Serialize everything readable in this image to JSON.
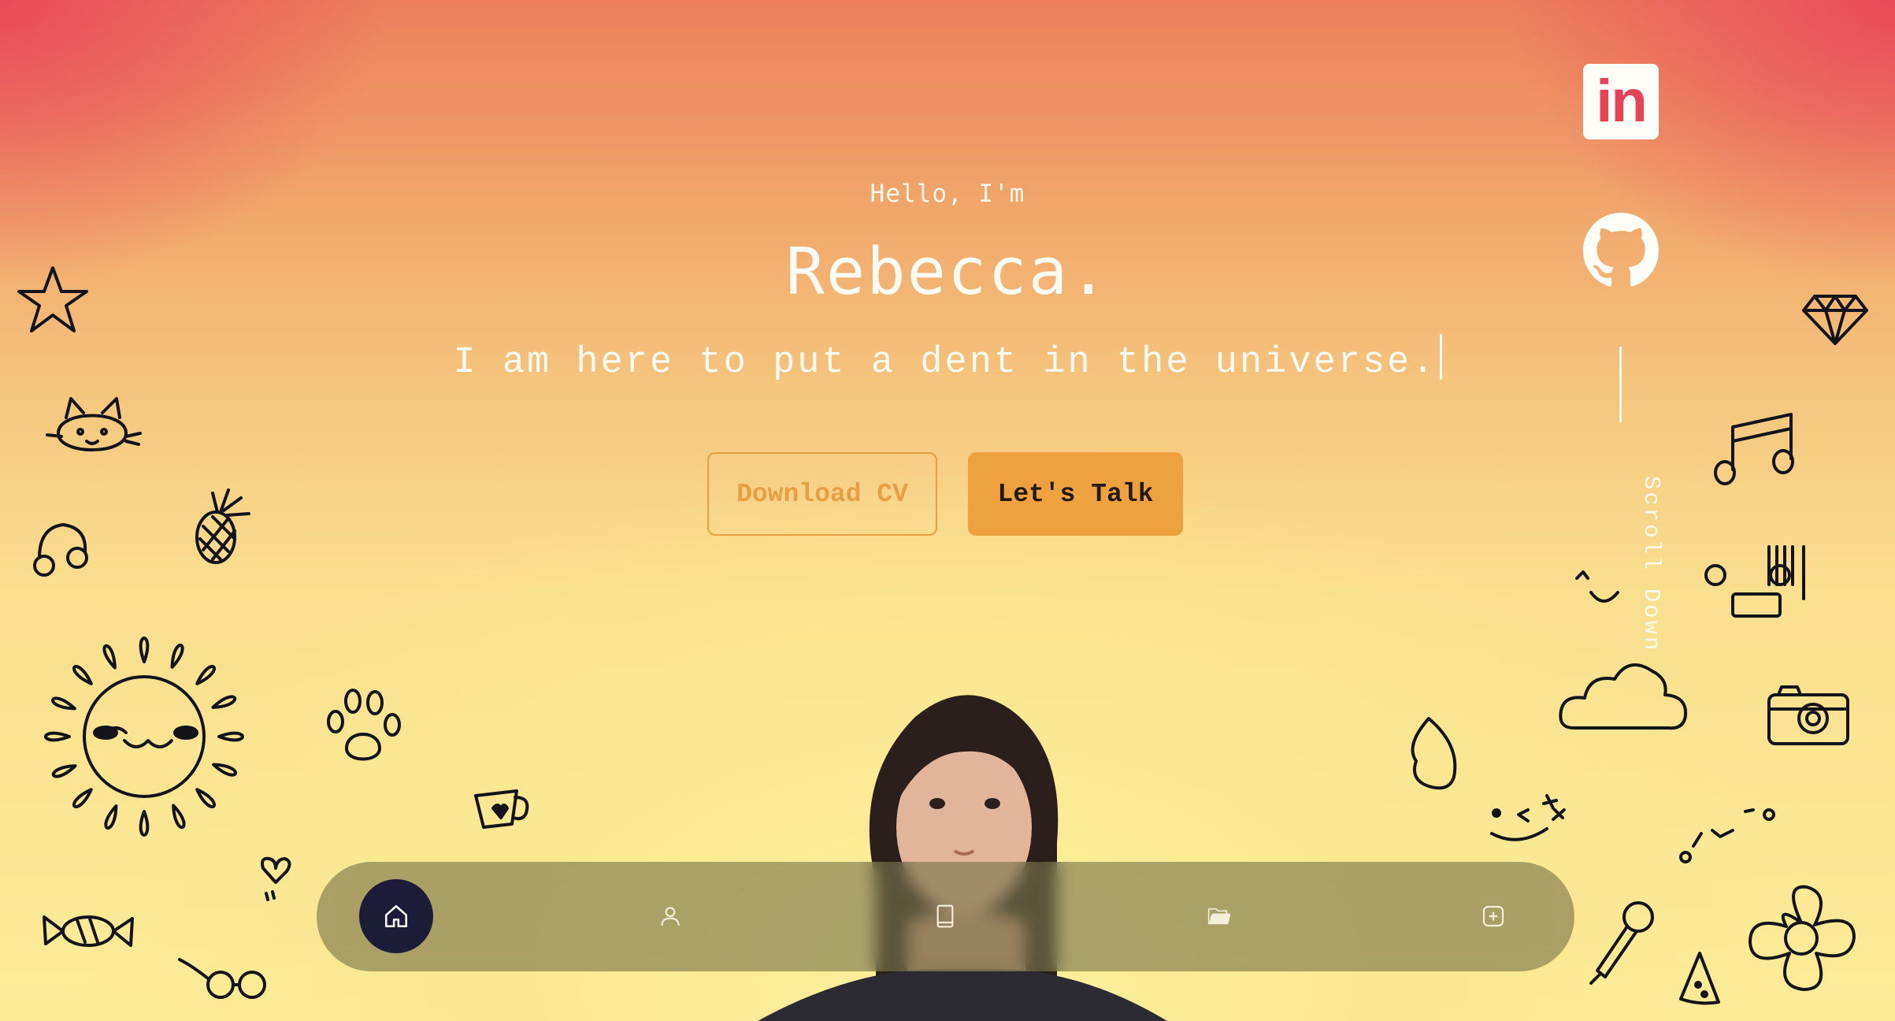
{
  "hero": {
    "greeting": "Hello, I'm",
    "name": "Rebecca.",
    "tagline": "I am here to put a dent in the universe."
  },
  "buttons": {
    "download_cv": "Download CV",
    "lets_talk": "Let's Talk"
  },
  "social": {
    "linkedin_label": "in",
    "linkedin_icon": "linkedin-icon",
    "github_icon": "github-icon"
  },
  "scroll": {
    "label": "Scroll Down"
  },
  "nav": {
    "items": [
      {
        "icon": "home-icon",
        "active": true
      },
      {
        "icon": "user-icon",
        "active": false
      },
      {
        "icon": "book-icon",
        "active": false
      },
      {
        "icon": "folder-icon",
        "active": false
      },
      {
        "icon": "plus-square-icon",
        "active": false
      }
    ]
  },
  "colors": {
    "accent": "#eda23f",
    "nav_active": "#1d1c38",
    "gradient_top": "#e84258",
    "gradient_bottom": "#fcec98"
  }
}
